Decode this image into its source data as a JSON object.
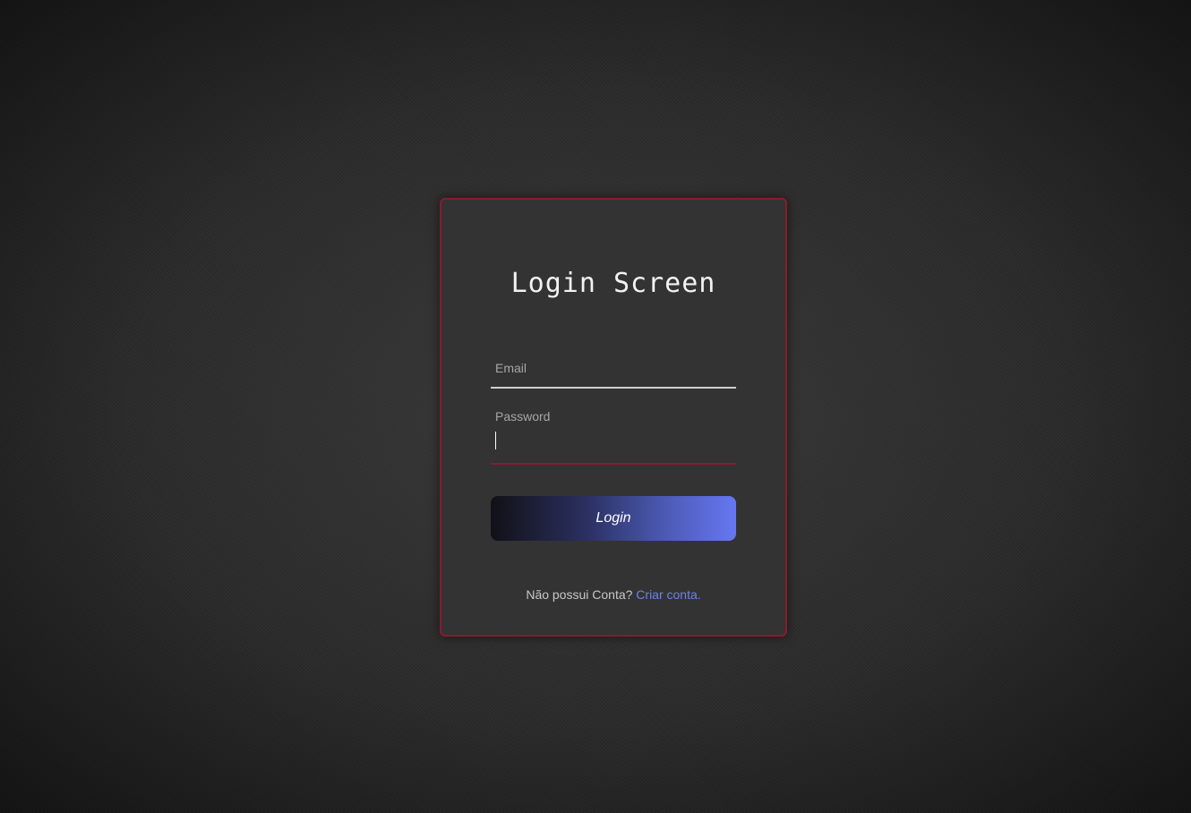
{
  "login": {
    "title": "Login Screen",
    "email_label": "Email",
    "email_value": "",
    "password_label": "Password",
    "password_value": "",
    "button_label": "Login",
    "signup_prompt": "Não possui Conta?",
    "signup_link": "Criar conta."
  },
  "colors": {
    "card_border": "#8b1a2c",
    "link": "#6f80ee",
    "button_gradient_start": "#111116",
    "button_gradient_end": "#6677f2"
  }
}
